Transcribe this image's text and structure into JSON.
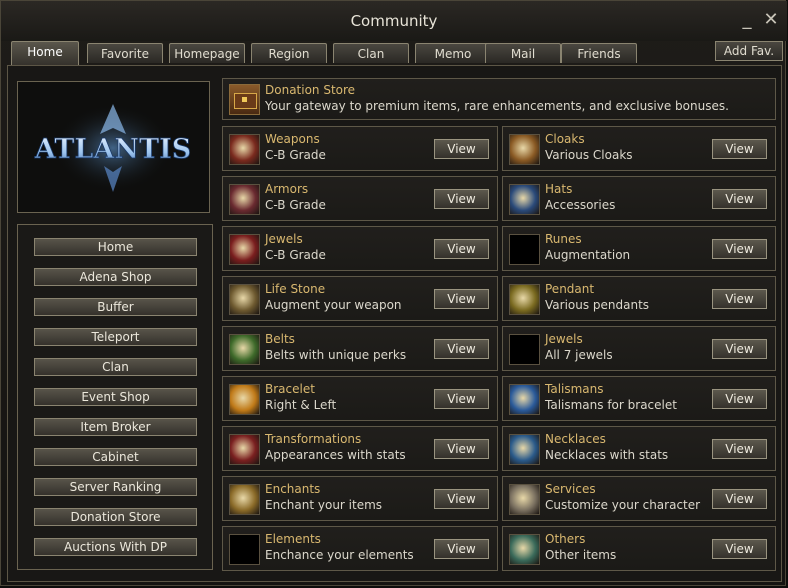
{
  "window": {
    "title": "Community",
    "minimize_glyph": "_",
    "close_glyph": "✕"
  },
  "tabs": [
    "Home",
    "Favorite",
    "Homepage",
    "Region",
    "Clan",
    "Memo",
    "Mail",
    "Friends"
  ],
  "active_tab": "Home",
  "add_fav_label": "Add Fav.",
  "logo_text": "ATLANTIS",
  "menu": [
    "Home",
    "Adena Shop",
    "Buffer",
    "Teleport",
    "Clan",
    "Event Shop",
    "Item Broker",
    "Cabinet",
    "Server Ranking",
    "Donation Store",
    "Auctions With DP"
  ],
  "banner": {
    "title": "Donation Store",
    "subtitle": "Your gateway to premium items, rare enhancements, and exclusive bonuses.",
    "icon": "treasure-chest-icon"
  },
  "view_label": "View",
  "left_cards": [
    {
      "title": "Weapons",
      "subtitle": "C-B Grade",
      "icon": "weapons-icon",
      "color": "#7a2a1e"
    },
    {
      "title": "Armors",
      "subtitle": "C-B Grade",
      "icon": "armor-icon",
      "color": "#6a2a30"
    },
    {
      "title": "Jewels",
      "subtitle": "C-B Grade",
      "icon": "jewel-icon",
      "color": "#7a1e1e"
    },
    {
      "title": "Life Stone",
      "subtitle": "Augment your weapon",
      "icon": "life-stone-icon",
      "color": "#6e5a30"
    },
    {
      "title": "Belts",
      "subtitle": "Belts with unique perks",
      "icon": "belt-icon",
      "color": "#3e6a2a"
    },
    {
      "title": "Bracelet",
      "subtitle": "Right & Left",
      "icon": "bracelet-icon",
      "color": "#c07a18"
    },
    {
      "title": "Transformations",
      "subtitle": "Appearances with stats",
      "icon": "transformation-book-icon",
      "color": "#7a2020"
    },
    {
      "title": "Enchants",
      "subtitle": "Enchant your items",
      "icon": "enchant-scroll-icon",
      "color": "#8a6a28"
    },
    {
      "title": "Elements",
      "subtitle": "Enchance your elements",
      "icon": "empty-slot-icon",
      "color": "#000000"
    }
  ],
  "right_cards": [
    {
      "title": "Cloaks",
      "subtitle": "Various Cloaks",
      "icon": "cloak-icon",
      "color": "#8a5a24"
    },
    {
      "title": "Hats",
      "subtitle": "Accessories",
      "icon": "hat-icon",
      "color": "#2a4a7a"
    },
    {
      "title": "Runes",
      "subtitle": "Augmentation",
      "icon": "empty-slot-icon",
      "color": "#000000"
    },
    {
      "title": "Pendant",
      "subtitle": "Various pendants",
      "icon": "pendant-icon",
      "color": "#7a6a20"
    },
    {
      "title": "Jewels",
      "subtitle": "All 7 jewels",
      "icon": "empty-slot-icon",
      "color": "#000000"
    },
    {
      "title": "Talismans",
      "subtitle": "Talismans for bracelet",
      "icon": "talisman-icon",
      "color": "#2a5a9a"
    },
    {
      "title": "Necklaces",
      "subtitle": "Necklaces with stats",
      "icon": "necklace-icon",
      "color": "#2a5a8a"
    },
    {
      "title": "Services",
      "subtitle": "Customize your character",
      "icon": "services-scroll-icon",
      "color": "#7a7060"
    },
    {
      "title": "Others",
      "subtitle": "Other items",
      "icon": "others-icon",
      "color": "#3a6a5a"
    }
  ]
}
